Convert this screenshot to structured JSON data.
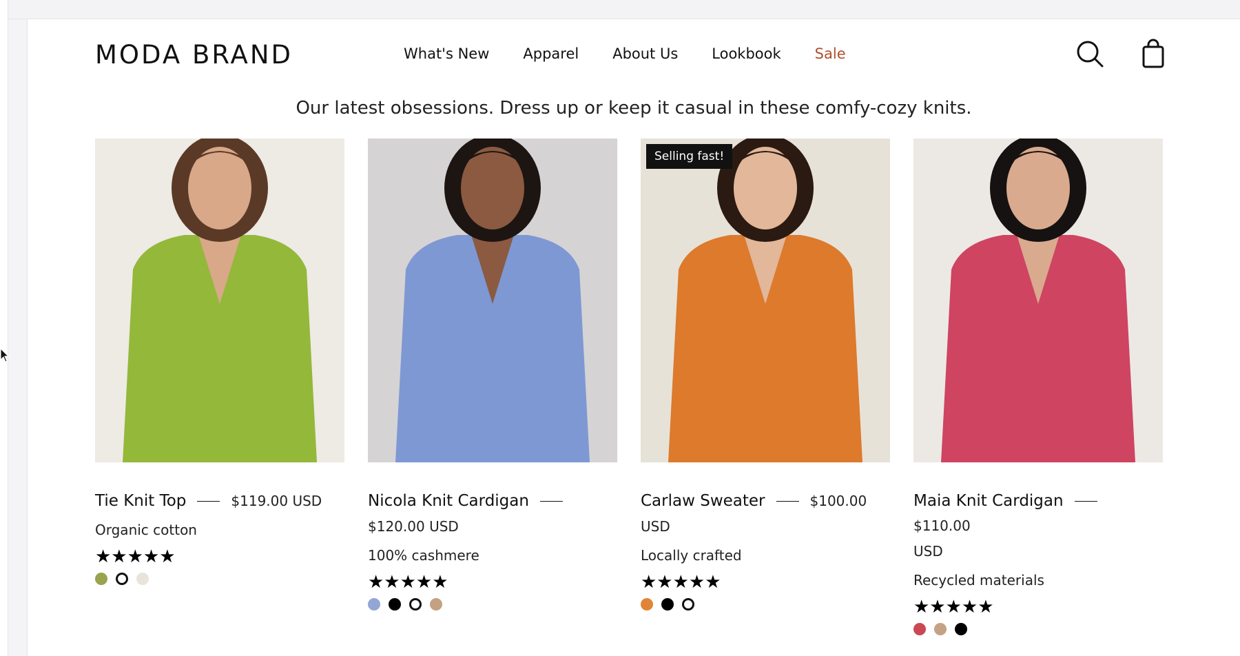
{
  "brand": "MODA BRAND",
  "nav": {
    "items": [
      "What's New",
      "Apparel",
      "About Us",
      "Lookbook",
      "Sale"
    ]
  },
  "icons": {
    "search": "search-icon",
    "bag": "shopping-bag-icon"
  },
  "tagline": "Our latest obsessions. Dress up or keep it casual in these comfy-cozy knits.",
  "colors": {
    "sale": "#b24d2b",
    "badge_bg": "#111111"
  },
  "products": [
    {
      "name": "Tie Knit Top",
      "price_part1": "$119.00 USD",
      "price_part2": "",
      "description": "Organic cotton",
      "rating": 5,
      "stars": "★★★★★",
      "badge": "",
      "swatches": [
        "#9aa34e",
        "ring",
        "#e8e4dc"
      ],
      "image": {
        "bg": "#eeeae4",
        "garment": "#94b83a",
        "hair": "#5a3a26",
        "skin": "#d8a888",
        "bottom": "#f2ede6"
      }
    },
    {
      "name": "Nicola Knit Cardigan",
      "price_part1": "",
      "price_part2": "$120.00 USD",
      "description": "100% cashmere",
      "rating": 5,
      "stars": "★★★★★",
      "badge": "",
      "swatches": [
        "#93a6d6",
        "#000000",
        "ring",
        "#c4a182"
      ],
      "image": {
        "bg": "#d6d3d5",
        "garment": "#7e98d4",
        "hair": "#1d1512",
        "skin": "#8b5a40",
        "bottom": "#8aa0d8"
      }
    },
    {
      "name": "Carlaw Sweater",
      "price_part1": "$100.00",
      "price_part2": "USD",
      "description": "Locally crafted",
      "rating": 5,
      "stars": "★★★★★",
      "badge": "Selling fast!",
      "swatches": [
        "#e08538",
        "#000000",
        "ring"
      ],
      "image": {
        "bg": "#e7e2d8",
        "garment": "#dd7a2c",
        "hair": "#2a1a12",
        "skin": "#e2b79a",
        "bottom": "#cfc7b8"
      }
    },
    {
      "name": "Maia Knit Cardigan",
      "price_part1": "$110.00",
      "price_part2": "USD",
      "description": "Recycled materials",
      "rating": 5,
      "stars": "★★★★★",
      "badge": "",
      "swatches": [
        "#c94854",
        "#c3a285",
        "#000000"
      ],
      "image": {
        "bg": "#ece9e5",
        "garment": "#cf4460",
        "hair": "#161212",
        "skin": "#d9aa8e",
        "bottom": "#f6f4f1"
      }
    }
  ]
}
